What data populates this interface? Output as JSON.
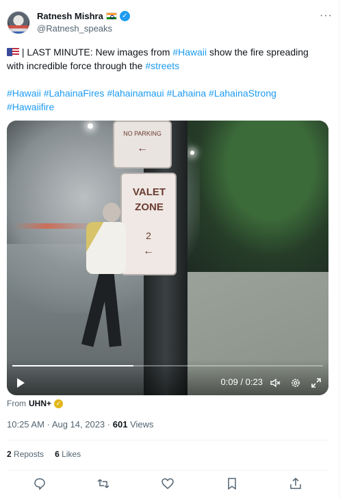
{
  "author": {
    "display_name": "Ratnesh Mishra",
    "handle": "@Ratnesh_speaks",
    "flag_icon": "india-flag-icon",
    "verified_icon": "verified-badge-icon"
  },
  "tweet": {
    "line1_prefix": "| LAST MINUTE: New images from ",
    "line1_link": "#Hawaii",
    "line1_suffix": " show the fire spreading",
    "line2_prefix": "with incredible force through the ",
    "line2_link": "#streets",
    "hashtags_row1": [
      "#Hawaii",
      "#LahainaFires",
      "#lahainamaui",
      "#Lahaina",
      "#LahainaStrong"
    ],
    "hashtags_row2": [
      "#Hawaiifire"
    ]
  },
  "video": {
    "time_display": "0:09 / 0:23",
    "progress_fraction": 0.39,
    "sign_top_text": "NO PARKING",
    "sign_bottom_text": "VALET ZONE",
    "sign_bottom_sub": "2"
  },
  "source": {
    "from_label": "From",
    "source_name": "UHN+"
  },
  "meta": {
    "time": "10:25 AM",
    "separator": "·",
    "date": "Aug 14, 2023",
    "views_count": "601",
    "views_label": "Views"
  },
  "stats": {
    "reposts_count": "2",
    "reposts_label": "Reposts",
    "likes_count": "6",
    "likes_label": "Likes"
  },
  "colors": {
    "accent": "#1d9bf0",
    "text": "#0f1419",
    "secondary": "#536471"
  }
}
